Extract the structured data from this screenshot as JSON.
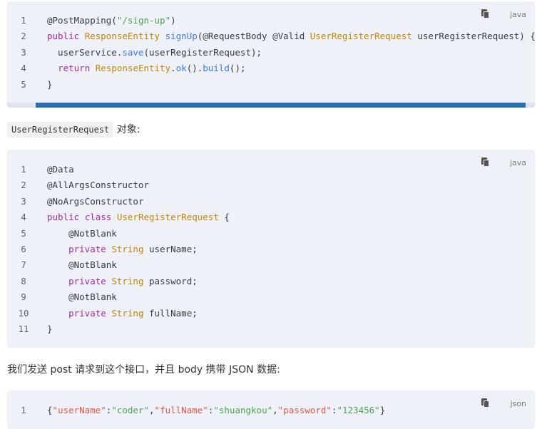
{
  "blocks": [
    {
      "language": "java",
      "lines": [
        {
          "n": "1",
          "tokens": [
            [
              "",
              "@PostMapping("
            ],
            [
              "s",
              "\"/sign-up\""
            ],
            [
              "",
              ")"
            ]
          ]
        },
        {
          "n": "2",
          "tokens": [
            [
              "k",
              "public"
            ],
            [
              "",
              " "
            ],
            [
              "t",
              "ResponseEntity"
            ],
            [
              "",
              " "
            ],
            [
              "f",
              "signUp"
            ],
            [
              "",
              "(@RequestBody @Valid "
            ],
            [
              "t",
              "UserRegisterRequest"
            ],
            [
              "",
              " userRegisterRequest) {"
            ]
          ]
        },
        {
          "n": "3",
          "tokens": [
            [
              "",
              "  userService."
            ],
            [
              "f",
              "save"
            ],
            [
              "",
              "(userRegisterRequest);"
            ]
          ]
        },
        {
          "n": "4",
          "tokens": [
            [
              "",
              "  "
            ],
            [
              "k",
              "return"
            ],
            [
              "",
              " "
            ],
            [
              "t",
              "ResponseEntity"
            ],
            [
              "",
              "."
            ],
            [
              "f",
              "ok"
            ],
            [
              "",
              "()."
            ],
            [
              "f",
              "build"
            ],
            [
              "",
              "();"
            ]
          ]
        },
        {
          "n": "5",
          "tokens": [
            [
              "",
              "}"
            ]
          ]
        }
      ]
    },
    {
      "language": "java",
      "lines": [
        {
          "n": "1",
          "tokens": [
            [
              "",
              "@Data"
            ]
          ]
        },
        {
          "n": "2",
          "tokens": [
            [
              "",
              "@AllArgsConstructor"
            ]
          ]
        },
        {
          "n": "3",
          "tokens": [
            [
              "",
              "@NoArgsConstructor"
            ]
          ]
        },
        {
          "n": "4",
          "tokens": [
            [
              "k",
              "public"
            ],
            [
              "",
              " "
            ],
            [
              "k",
              "class"
            ],
            [
              "",
              " "
            ],
            [
              "t",
              "UserRegisterRequest"
            ],
            [
              "",
              " {"
            ]
          ]
        },
        {
          "n": "5",
          "tokens": [
            [
              "",
              "    @NotBlank"
            ]
          ]
        },
        {
          "n": "6",
          "tokens": [
            [
              "",
              "    "
            ],
            [
              "k",
              "private"
            ],
            [
              "",
              " "
            ],
            [
              "t",
              "String"
            ],
            [
              "",
              " userName;"
            ]
          ]
        },
        {
          "n": "7",
          "tokens": [
            [
              "",
              "    @NotBlank"
            ]
          ]
        },
        {
          "n": "8",
          "tokens": [
            [
              "",
              "    "
            ],
            [
              "k",
              "private"
            ],
            [
              "",
              " "
            ],
            [
              "t",
              "String"
            ],
            [
              "",
              " password;"
            ]
          ]
        },
        {
          "n": "9",
          "tokens": [
            [
              "",
              "    @NotBlank"
            ]
          ]
        },
        {
          "n": "10",
          "tokens": [
            [
              "",
              "    "
            ],
            [
              "k",
              "private"
            ],
            [
              "",
              " "
            ],
            [
              "t",
              "String"
            ],
            [
              "",
              " fullName;"
            ]
          ]
        },
        {
          "n": "11",
          "tokens": [
            [
              "",
              "}"
            ]
          ]
        }
      ]
    },
    {
      "language": "json",
      "lines": [
        {
          "n": "1",
          "tokens": [
            [
              "",
              "{"
            ],
            [
              "tok-json-key",
              "\"userName\""
            ],
            [
              "",
              ":"
            ],
            [
              "s",
              "\"coder\""
            ],
            [
              "",
              ","
            ],
            [
              "tok-json-key",
              "\"fullName\""
            ],
            [
              "",
              ":"
            ],
            [
              "s",
              "\"shuangkou\""
            ],
            [
              "",
              ","
            ],
            [
              "tok-json-key",
              "\"password\""
            ],
            [
              "",
              ":"
            ],
            [
              "s",
              "\"123456\""
            ],
            [
              "",
              "}"
            ]
          ]
        }
      ]
    }
  ],
  "text1": {
    "code": "UserRegisterRequest",
    "suffix": " 对象:"
  },
  "text2": "我们发送 post 请求到这个接口，并且 body 携带 JSON 数据:",
  "colors": {
    "keyword": "#a626a4",
    "type": "#c18401",
    "function": "#4078f2",
    "string": "#50a14f",
    "json_key": "#e45649",
    "scrollbar": "#2b71b6"
  },
  "icons": {
    "copy": "copy-icon"
  }
}
